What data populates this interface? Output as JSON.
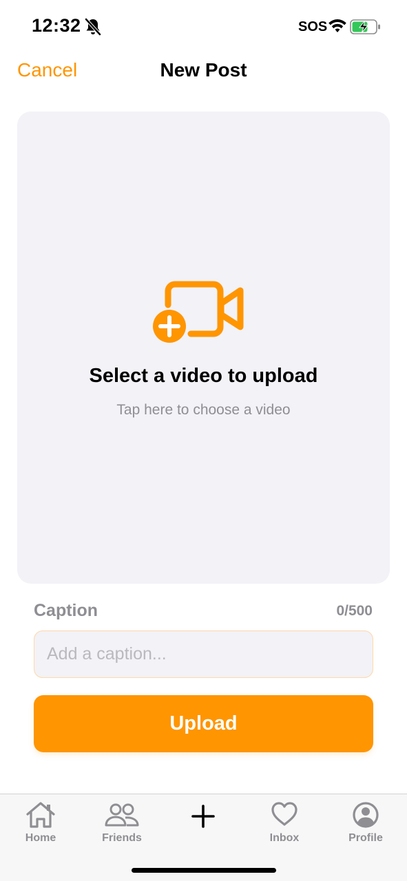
{
  "status_bar": {
    "time": "12:32",
    "carrier": "SOS",
    "icons": [
      "bell-slash-icon",
      "wifi-icon",
      "battery-charging-icon"
    ]
  },
  "header": {
    "cancel_label": "Cancel",
    "title": "New Post"
  },
  "upload_area": {
    "icon": "video-add-icon",
    "title": "Select a video to upload",
    "subtitle": "Tap here to choose a video"
  },
  "caption": {
    "label": "Caption",
    "count": "0/500",
    "value": "",
    "placeholder": "Add a caption..."
  },
  "upload_button": {
    "label": "Upload"
  },
  "tab_bar": {
    "items": [
      {
        "label": "Home",
        "icon": "home-icon"
      },
      {
        "label": "Friends",
        "icon": "friends-icon"
      },
      {
        "label": "",
        "icon": "plus-icon"
      },
      {
        "label": "Inbox",
        "icon": "heart-icon"
      },
      {
        "label": "Profile",
        "icon": "profile-icon"
      }
    ]
  },
  "colors": {
    "accent": "#FF9500",
    "upload_area_bg": "#F2F2F7",
    "secondary_text": "#8E8E93"
  }
}
